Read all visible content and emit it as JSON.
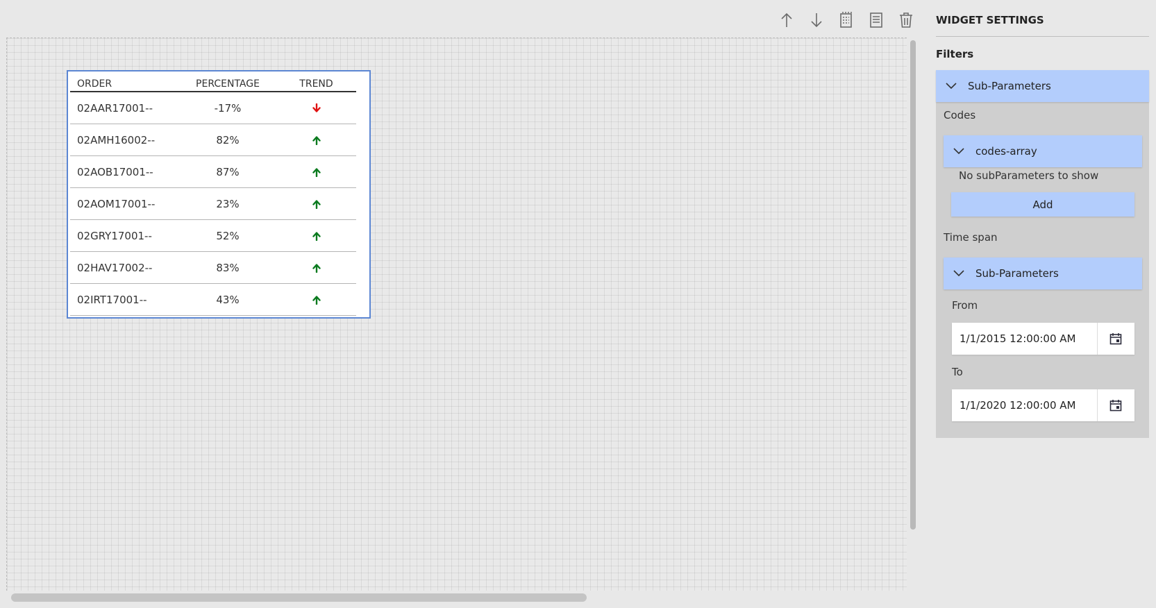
{
  "toolbar": {
    "icons": [
      "move-up-icon",
      "move-down-icon",
      "copy-icon",
      "document-icon",
      "trash-icon"
    ]
  },
  "table": {
    "headers": {
      "order": "ORDER",
      "percentage": "PERCENTAGE",
      "trend": "TREND"
    },
    "rows": [
      {
        "order": "02AAR17001--",
        "percentage": "-17%",
        "trend": "down"
      },
      {
        "order": "02AMH16002--",
        "percentage": "82%",
        "trend": "up"
      },
      {
        "order": "02AOB17001--",
        "percentage": "87%",
        "trend": "up"
      },
      {
        "order": "02AOM17001--",
        "percentage": "23%",
        "trend": "up"
      },
      {
        "order": "02GRY17001--",
        "percentage": "52%",
        "trend": "up"
      },
      {
        "order": "02HAV17002--",
        "percentage": "83%",
        "trend": "up"
      },
      {
        "order": "02IRT17001--",
        "percentage": "43%",
        "trend": "up"
      }
    ],
    "colors": {
      "up": "#0a7a1e",
      "down": "#e01010",
      "border": "#5b86d3"
    }
  },
  "settings": {
    "title": "WIDGET SETTINGS",
    "filters_label": "Filters",
    "sub_parameters_label": "Sub-Parameters",
    "codes_label": "Codes",
    "codes_array_label": "codes-array",
    "no_subparams_text": "No subParameters to show",
    "add_label": "Add",
    "time_span_label": "Time span",
    "time_span_sub_label": "Sub-Parameters",
    "from_label": "From",
    "from_value": "1/1/2015 12:00:00 AM",
    "to_label": "To",
    "to_value": "1/1/2020 12:00:00 AM",
    "accent_color": "#b3cdfc"
  }
}
